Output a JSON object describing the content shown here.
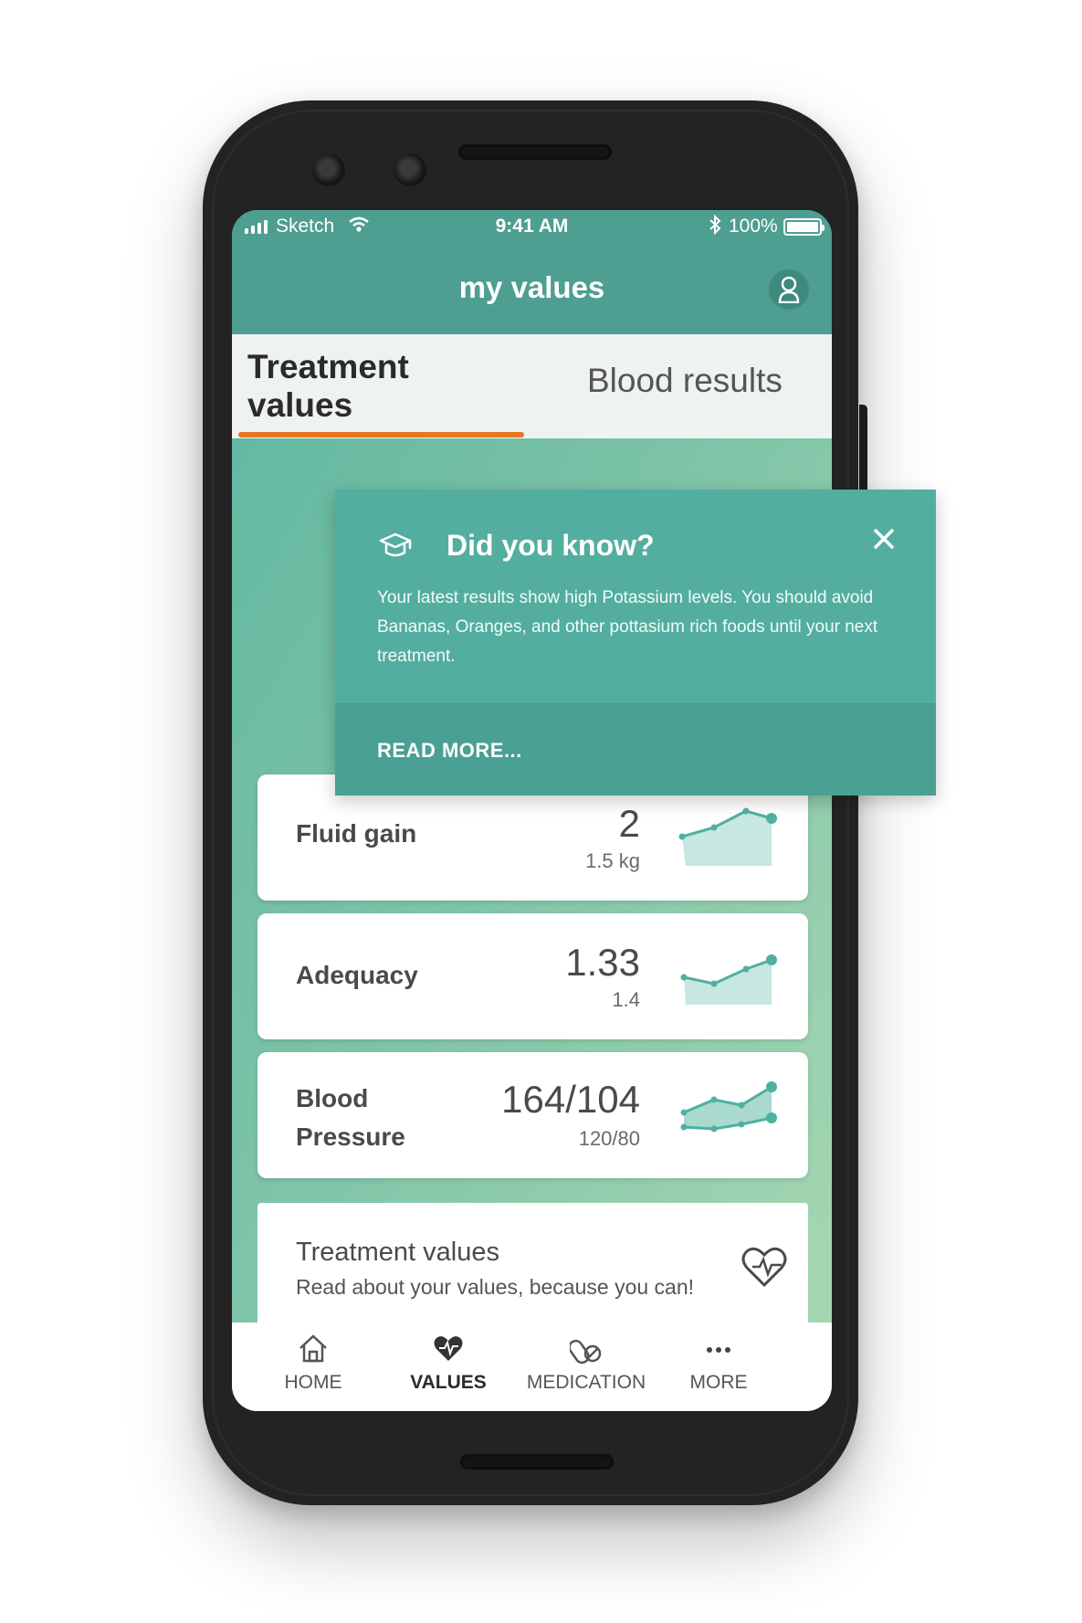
{
  "status_bar": {
    "carrier": "Sketch",
    "time": "9:41 AM",
    "battery": "100%",
    "icons": [
      "signal-icon",
      "wifi-icon",
      "bluetooth-icon",
      "battery-icon"
    ]
  },
  "appbar": {
    "title": "my values",
    "profile_icon": "user-icon"
  },
  "tabs": [
    {
      "label": "Treatment values",
      "active": true
    },
    {
      "label": "Blood results",
      "active": false
    }
  ],
  "tooltip": {
    "icon": "graduation-cap-icon",
    "title": "Did you know?",
    "body": "Your latest results show high Potassium levels. You should avoid Bananas, Oranges, and other pottasium rich foods until your next treatment.",
    "link": "READ MORE..."
  },
  "cards": [
    {
      "label": "Fluid gain",
      "value": "2",
      "target": "1.5 kg"
    },
    {
      "label": "Adequacy",
      "value": "1.33",
      "target": "1.4"
    },
    {
      "label_line1": "Blood",
      "label_line2": "Pressure",
      "value": "164/104",
      "target": "120/80"
    }
  ],
  "info_card": {
    "title": "Treatment values",
    "subtitle": "Read about your values, because you can!",
    "icon": "heart-pulse-icon"
  },
  "bottom_nav": [
    {
      "label": "HOME",
      "icon": "home-icon"
    },
    {
      "label": "VALUES",
      "icon": "heart-icon",
      "active": true
    },
    {
      "label": "MEDICATION",
      "icon": "pill-icon"
    },
    {
      "label": "MORE",
      "icon": "more-icon"
    }
  ],
  "colors": {
    "primary": "#4e9e91",
    "tooltip": "#53ae9f",
    "accent": "#e87524",
    "sparkline": "#4fb0a0",
    "sparkline_fill": "#c7e7e1"
  }
}
